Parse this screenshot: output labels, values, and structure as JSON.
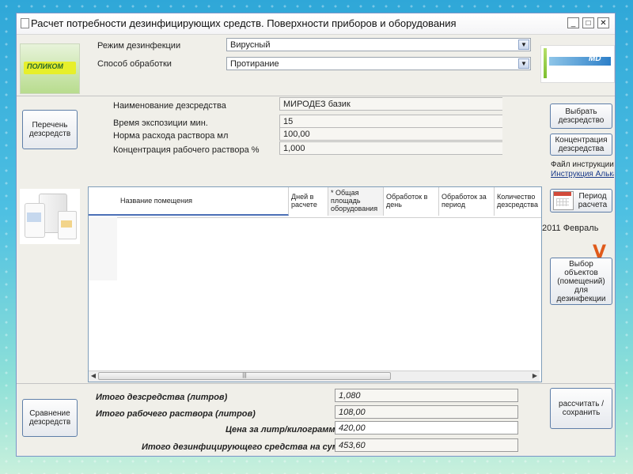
{
  "window": {
    "title": "Расчет потребности дезинфицирующих средств. Поверхности приборов и оборудования"
  },
  "mode": {
    "label": "Режим дезинфекции",
    "value": "Вирусный"
  },
  "method": {
    "label": "Способ обработки",
    "value": "Протирание"
  },
  "logo_left": "ПОЛИКОМ",
  "product": {
    "name_label": "Наименование дезсредства",
    "name_value": "МИРОДЕЗ базик",
    "exposure_label": "Время экспозиции мин.",
    "exposure_value": "15",
    "consumption_label": "Норма расхода раствора мл",
    "consumption_value": "100,00",
    "concentration_label": "Концентрация рабочего раствора %",
    "concentration_value": "1,000"
  },
  "buttons": {
    "disinfectant_list": "Перечень дезсредств",
    "choose_disinfectant": "Выбрать дезсредство",
    "concentration": "Концентрация дезсредства",
    "period": "Период расчета",
    "choose_objects": "Выбор объектов (помещений) для дезинфекции",
    "compare": "Сравнение дезсредств",
    "calculate": "рассчитать / сохранить"
  },
  "instruction": {
    "label": "Файл инструкции",
    "link": "Инструкция Алька"
  },
  "period_value": "2011 Февраль",
  "table": {
    "columns": [
      "Название помещения",
      "Дней в расчете",
      "* Общая площадь оборудования",
      "Обработок в день",
      "Обработок за период",
      "Количество дезсредства"
    ],
    "rows": []
  },
  "mark": "V",
  "totals": {
    "disinfectant_label": "Итого дезсредства (литров)",
    "disinfectant_value": "1,080",
    "solution_label": "Итого рабочего раствора (литров)",
    "solution_value": "108,00",
    "price_label": "Цена за литр/килограмм",
    "price_value": "420,00",
    "sum_label": "Итого дезинфицирующего средства на сумму",
    "sum_value": "453,60"
  },
  "colors": {
    "accent": "#1a4fa0",
    "mark": "#e05a1a",
    "link": "#1a3a8a"
  }
}
